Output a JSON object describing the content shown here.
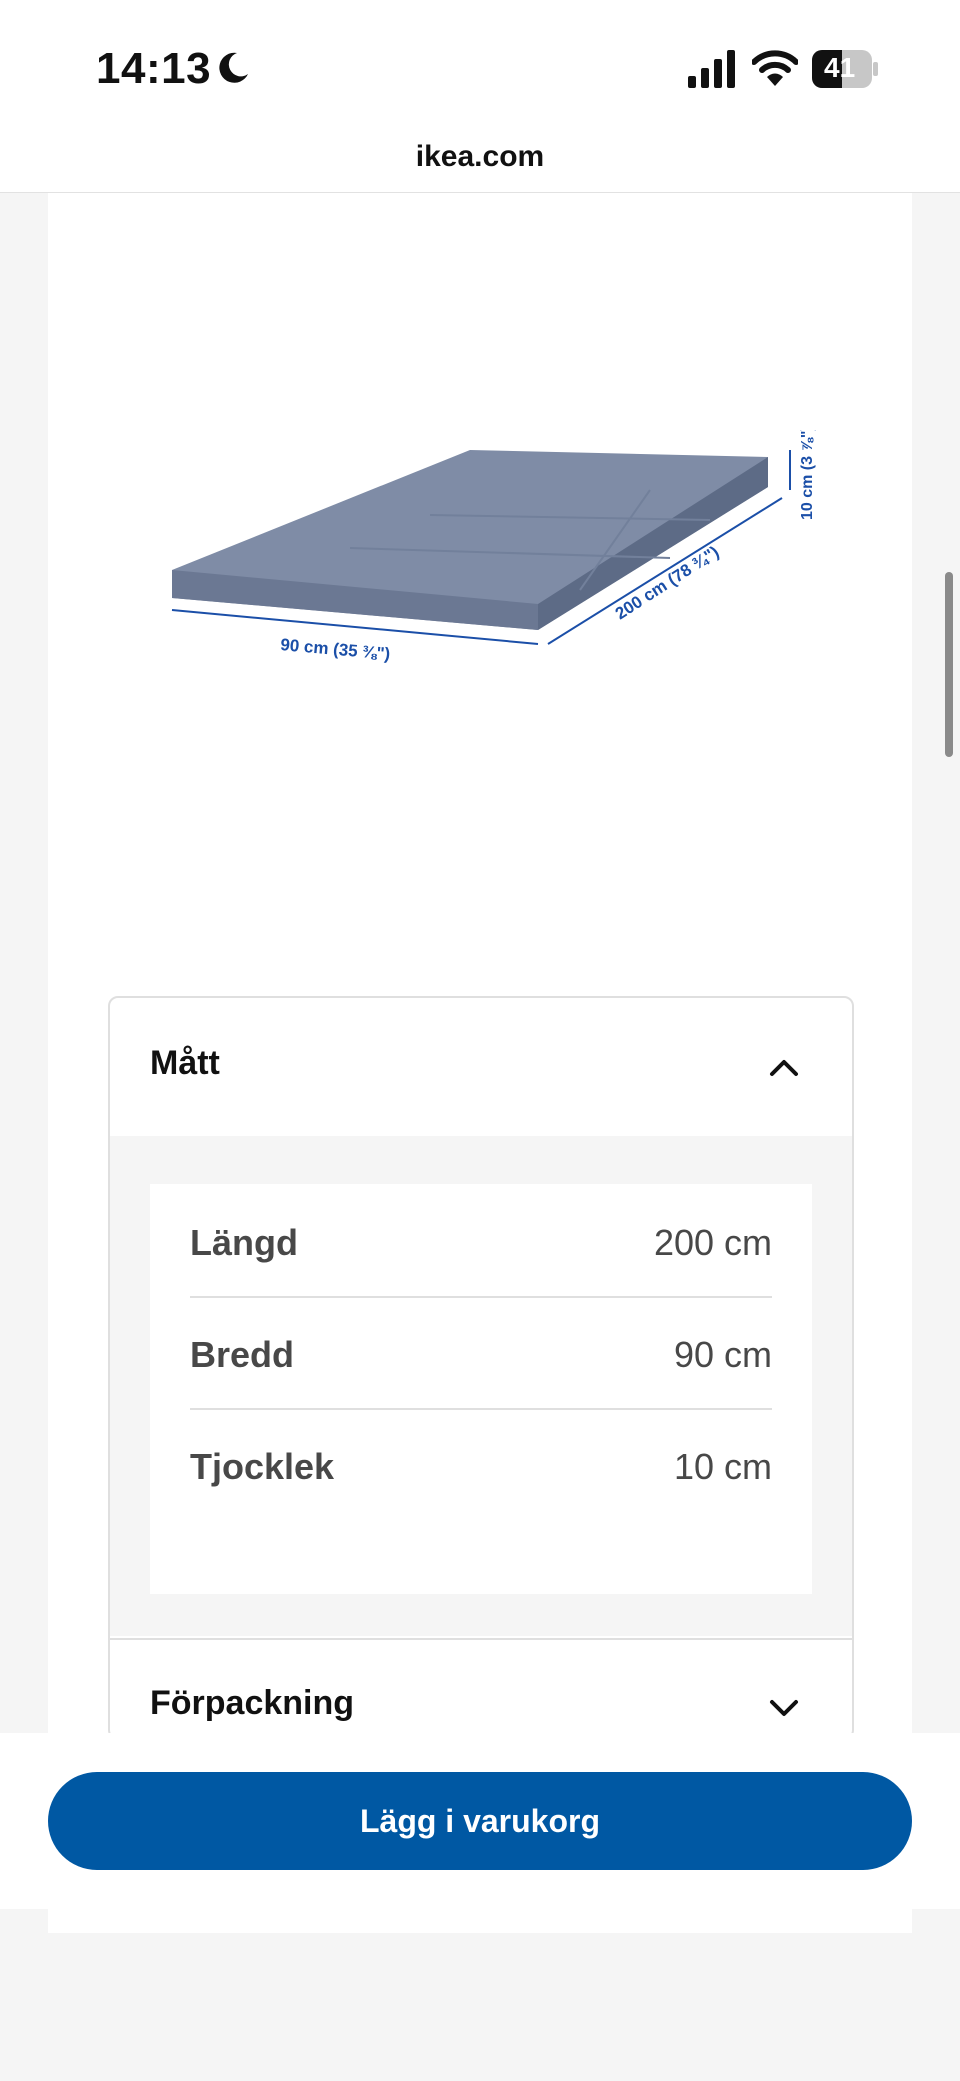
{
  "status_bar": {
    "time": "14:13",
    "battery": "41",
    "icons": [
      "moon-icon",
      "signal-icon",
      "wifi-icon",
      "battery-icon"
    ]
  },
  "browser": {
    "url": "ikea.com"
  },
  "product_image": {
    "width_label": "90 cm (35 ⅜\")",
    "length_label": "200 cm (78 ¾\")",
    "thickness_label": "10 cm (3 ⅞\")",
    "colors": {
      "mattress": "#7f8ca6",
      "dimension_lines": "#1b4fa8"
    }
  },
  "accordion": {
    "matt": {
      "title": "Mått",
      "expanded": true,
      "rows": [
        {
          "label": "Längd",
          "value": "200 cm"
        },
        {
          "label": "Bredd",
          "value": "90 cm"
        },
        {
          "label": "Tjocklek",
          "value": "10 cm"
        }
      ]
    },
    "forpackning": {
      "title": "Förpackning",
      "expanded": false
    }
  },
  "cart": {
    "label": "Lägg i varukorg",
    "color": "#0058a3"
  }
}
